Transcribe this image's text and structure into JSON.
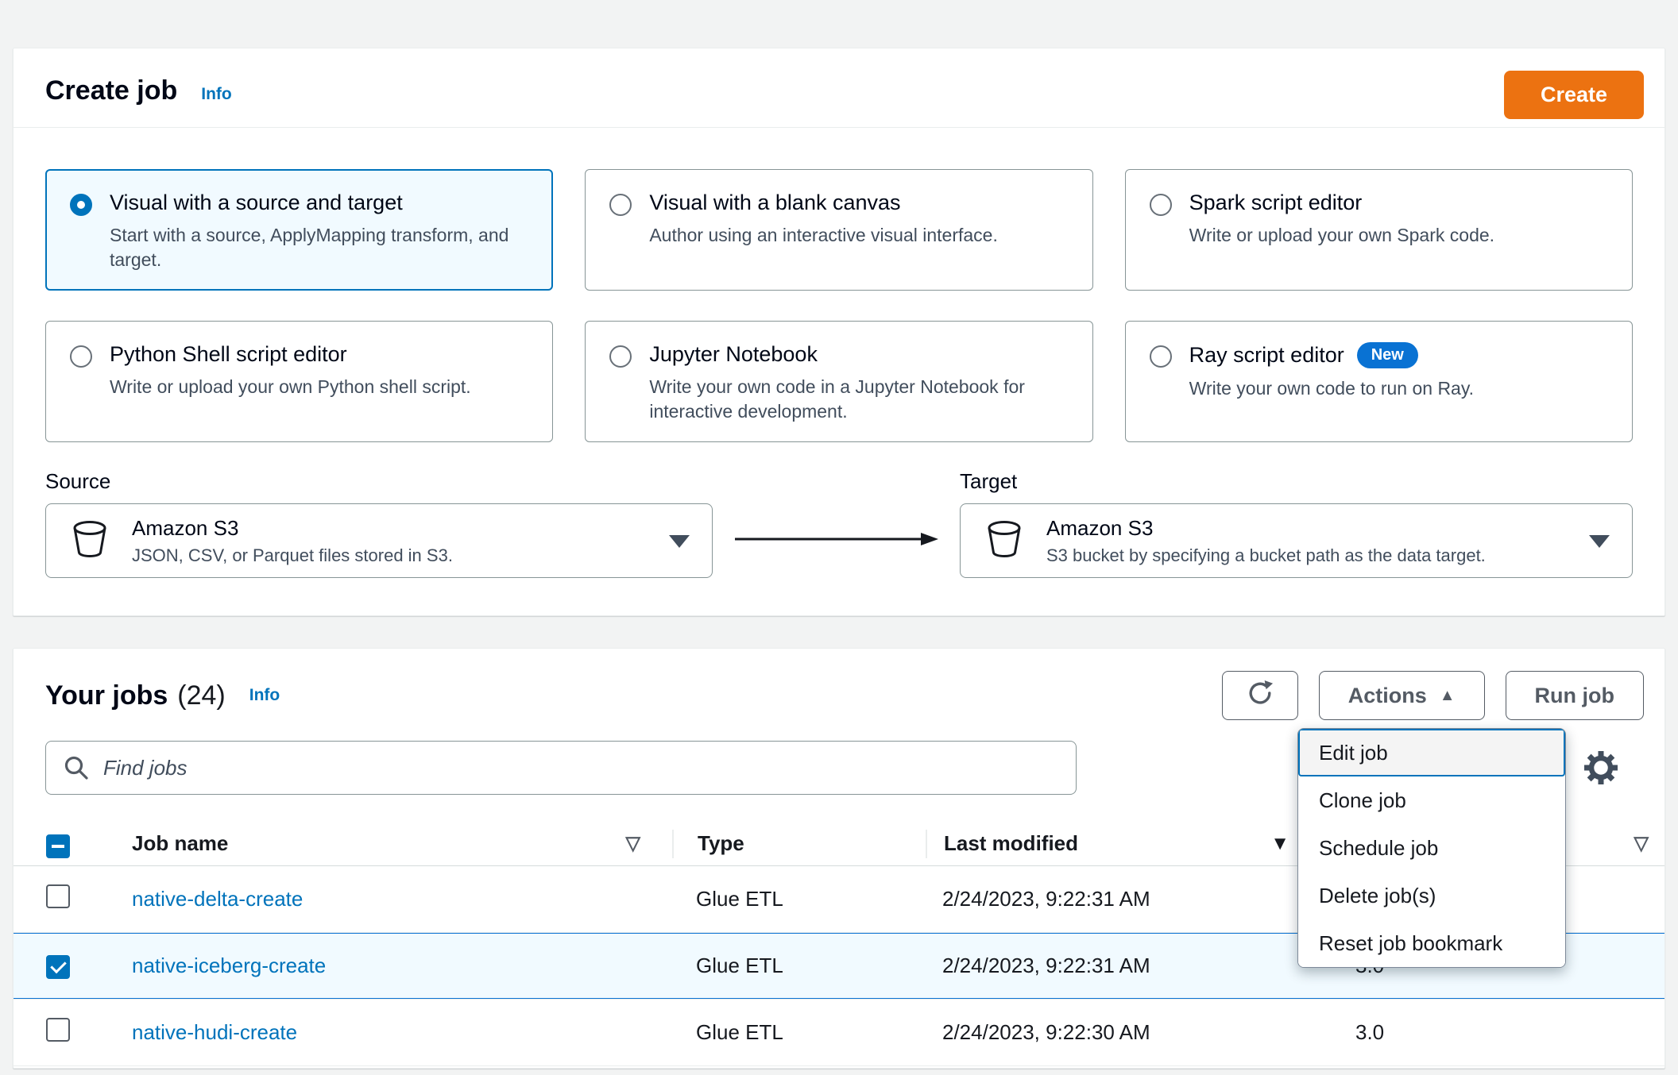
{
  "colors": {
    "page_background": "#f2f3f3",
    "primary_button_orange": "#ec7211",
    "link_blue": "#0073bb",
    "selected_option_background": "#f1faff",
    "selected_row_background": "#f1faff",
    "border_gray": "#879596"
  },
  "icons": {
    "search": "magnifier",
    "settings": "gear",
    "refresh": "circular-arrow",
    "s3": "bucket",
    "flow_arrow": "right-arrow",
    "caret_up": "▲",
    "filter": "▽",
    "sort_desc": "▼"
  },
  "create_panel": {
    "title": "Create job",
    "info_label": "Info",
    "create_button": "Create",
    "options": [
      {
        "label": "Visual with a source and target",
        "description": "Start with a source, ApplyMapping transform, and target.",
        "selected": true
      },
      {
        "label": "Visual with a blank canvas",
        "description": "Author using an interactive visual interface.",
        "selected": false
      },
      {
        "label": "Spark script editor",
        "description": "Write or upload your own Spark code.",
        "selected": false
      },
      {
        "label": "Python Shell script editor",
        "description": "Write or upload your own Python shell script.",
        "selected": false
      },
      {
        "label": "Jupyter Notebook",
        "description": "Write your own code in a Jupyter Notebook for interactive development.",
        "selected": false
      },
      {
        "label": "Ray script editor",
        "badge": "New",
        "description": "Write your own code to run on Ray.",
        "selected": false
      }
    ],
    "source": {
      "label": "Source",
      "name": "Amazon S3",
      "description": "JSON, CSV, or Parquet files stored in S3."
    },
    "target": {
      "label": "Target",
      "name": "Amazon S3",
      "description": "S3 bucket by specifying a bucket path as the data target."
    }
  },
  "jobs_panel": {
    "title": "Your jobs",
    "count": "(24)",
    "info_label": "Info",
    "search_placeholder": "Find jobs",
    "actions_button": "Actions",
    "run_job_button": "Run job",
    "menu_items": [
      "Edit job",
      "Clone job",
      "Schedule job",
      "Delete job(s)",
      "Reset job bookmark"
    ],
    "table": {
      "columns": [
        "Job name",
        "Type",
        "Last modified"
      ],
      "header_checkbox_state": "indeterminate",
      "rows": [
        {
          "name": "native-delta-create",
          "type": "Glue ETL",
          "last_modified": "2/24/2023, 9:22:31 AM",
          "glue_version": "",
          "checked": false
        },
        {
          "name": "native-iceberg-create",
          "type": "Glue ETL",
          "last_modified": "2/24/2023, 9:22:31 AM",
          "glue_version": "3.0",
          "checked": true
        },
        {
          "name": "native-hudi-create",
          "type": "Glue ETL",
          "last_modified": "2/24/2023, 9:22:30 AM",
          "glue_version": "3.0",
          "checked": false
        }
      ]
    }
  }
}
